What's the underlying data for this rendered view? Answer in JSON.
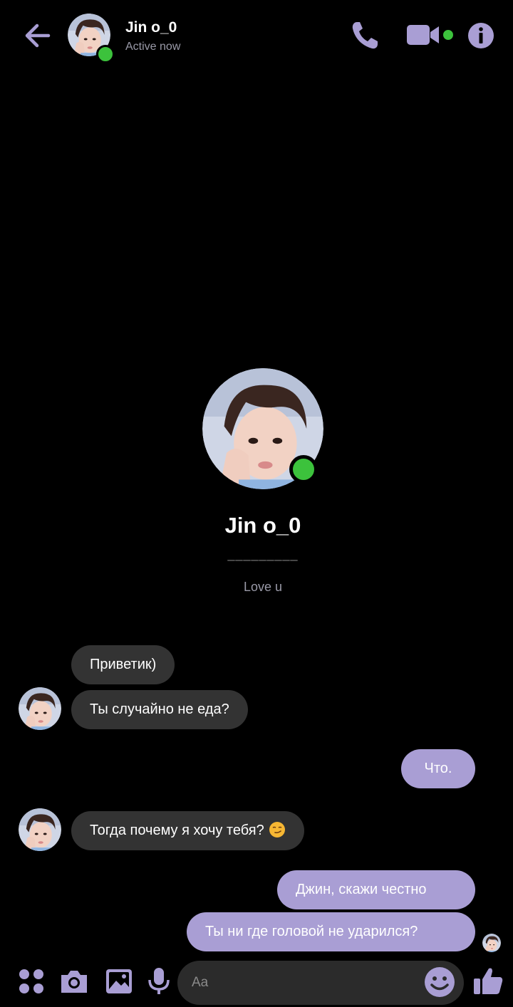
{
  "header": {
    "contact_name": "Jin o_0",
    "status": "Active now"
  },
  "profile": {
    "name": "Jin o_0",
    "divider": "_________",
    "bio": "Love u"
  },
  "messages": [
    {
      "from": "contact",
      "text": "Приветик)"
    },
    {
      "from": "contact",
      "text": "Ты случайно не еда?"
    },
    {
      "from": "me",
      "text": "Что."
    },
    {
      "from": "contact",
      "text": "Тогда почему я хочу тебя?"
    },
    {
      "from": "me",
      "text": "Джин, скажи честно"
    },
    {
      "from": "me",
      "text": "Ты ни где головой не ударился?"
    }
  ],
  "composer": {
    "placeholder": "Aa"
  },
  "colors": {
    "accent": "#a99ed4",
    "online": "#3cc23c",
    "incoming_bubble": "#333333"
  },
  "icons": [
    "back-arrow-icon",
    "phone-icon",
    "video-camera-icon",
    "info-icon",
    "apps-grid-icon",
    "camera-icon",
    "image-icon",
    "microphone-icon",
    "emoji-icon",
    "thumbs-up-icon"
  ]
}
